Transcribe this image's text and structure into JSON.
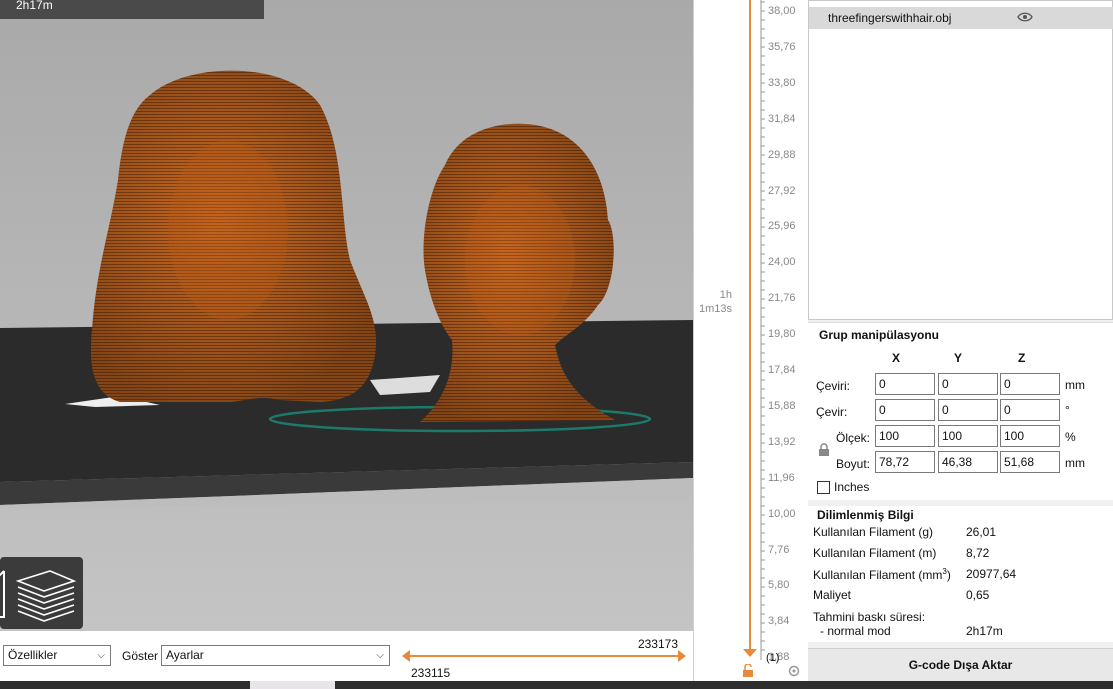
{
  "viewport": {
    "print_time_badge": "2h17m",
    "view_mode_icon": "view-3d-icon",
    "layers_icon": "layers-icon"
  },
  "bottom_bar": {
    "feature_select": "Özellikler",
    "show_label": "Göster",
    "show_select": "Ayarlar",
    "hslider_max": "233173",
    "hslider_min": "233115"
  },
  "vertical_slider": {
    "ticks": [
      "38,00",
      "35,76",
      "33,80",
      "31,84",
      "29,88",
      "27,92",
      "25,96",
      "24,00",
      "21,76",
      "19,80",
      "17,84",
      "15,88",
      "13,92",
      "11,96",
      "10,00",
      "7,76",
      "5,80",
      "3,84",
      "1,88",
      "0,20"
    ],
    "bottom_index": "(1)",
    "time_hours": "1h",
    "time_minutes": "1m13s",
    "accent_color": "#e8893b"
  },
  "object_list": {
    "items": [
      {
        "name": "threefingerswithhair.obj",
        "visible_icon": "eye-icon"
      }
    ]
  },
  "group_manipulation": {
    "title": "Grup manipülasyonu",
    "columns": [
      "X",
      "Y",
      "Z"
    ],
    "rows": [
      {
        "label": "Çeviri:",
        "x": "0",
        "y": "0",
        "z": "0",
        "unit": "mm"
      },
      {
        "label": "Çevir:",
        "x": "0",
        "y": "0",
        "z": "0",
        "unit": "°"
      },
      {
        "label": "Ölçek:",
        "x": "100",
        "y": "100",
        "z": "100",
        "unit": "%"
      },
      {
        "label": "Boyut:",
        "x": "78,72",
        "y": "46,38",
        "z": "51,68",
        "unit": "mm"
      }
    ],
    "inches_label": "Inches",
    "inches_checked": false
  },
  "sliced_info": {
    "title": "Dilimlenmiş Bilgi",
    "filament_g_label": "Kullanılan Filament (g)",
    "filament_g": "26,01",
    "filament_m_label": "Kullanılan Filament (m)",
    "filament_m": "8,72",
    "filament_mm3_label": "Kullanılan Filament (mm",
    "filament_mm3_sup": "3",
    "filament_mm3_close": ")",
    "filament_mm3": "20977,64",
    "cost_label": "Maliyet",
    "cost": "0,65",
    "est_time_label": "Tahmini baskı süresi:",
    "mode_label": "- normal mod",
    "mode_time": "2h17m"
  },
  "export_button": "G-code Dışa Aktar",
  "colors": {
    "model_orange": "#c2641e",
    "bed_dark": "#2a2a2a",
    "skirt_teal": "#1c7a6a"
  }
}
